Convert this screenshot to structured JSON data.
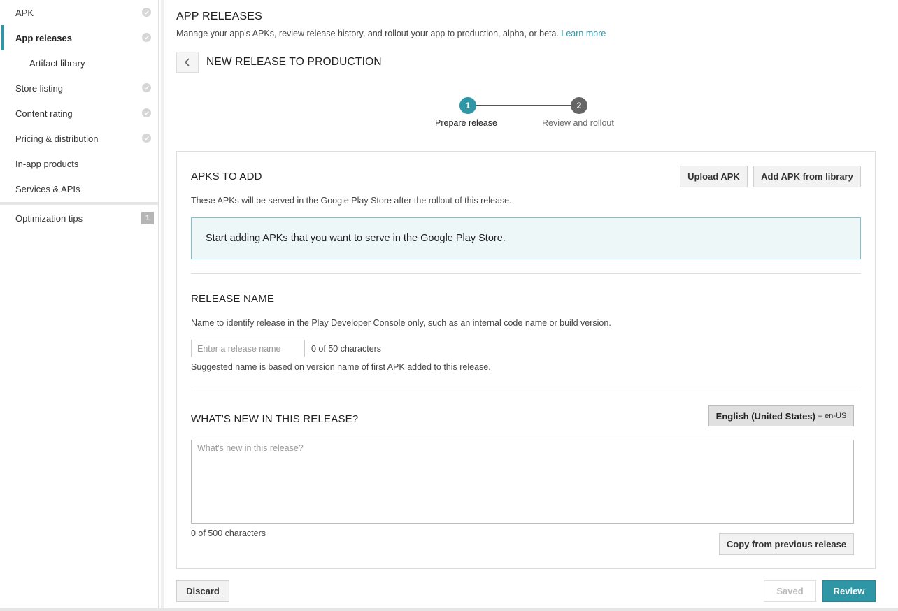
{
  "sidebar": {
    "items": [
      {
        "label": "APK"
      },
      {
        "label": "App releases"
      },
      {
        "label": "Artifact library"
      },
      {
        "label": "Store listing"
      },
      {
        "label": "Content rating"
      },
      {
        "label": "Pricing & distribution"
      },
      {
        "label": "In-app products"
      },
      {
        "label": "Services & APIs"
      }
    ],
    "optimization": {
      "label": "Optimization tips",
      "badge": "1"
    }
  },
  "header": {
    "title": "APP RELEASES",
    "description": "Manage your app's APKs, review release history, and rollout your app to production, alpha, or beta.",
    "learn_more": "Learn more",
    "page_title": "NEW RELEASE TO PRODUCTION"
  },
  "stepper": {
    "steps": [
      {
        "number": "1",
        "label": "Prepare release"
      },
      {
        "number": "2",
        "label": "Review and rollout"
      }
    ]
  },
  "apks": {
    "title": "APKS TO ADD",
    "upload_label": "Upload APK",
    "add_from_library_label": "Add APK from library",
    "description": "These APKs will be served in the Google Play Store after the rollout of this release.",
    "empty_message": "Start adding APKs that you want to serve in the Google Play Store."
  },
  "release_name": {
    "title": "RELEASE NAME",
    "description": "Name to identify release in the Play Developer Console only, such as an internal code name or build version.",
    "placeholder": "Enter a release name",
    "value": "",
    "counter": "0 of 50 characters",
    "hint": "Suggested name is based on version name of first APK added to this release."
  },
  "whats_new": {
    "title": "WHAT'S NEW IN THIS RELEASE?",
    "language_label": "English (United States)",
    "language_code": "– en-US",
    "placeholder": "What's new in this release?",
    "value": "",
    "counter": "0 of 500 characters",
    "copy_label": "Copy from previous release"
  },
  "footer": {
    "discard_label": "Discard",
    "saved_label": "Saved",
    "review_label": "Review"
  },
  "colors": {
    "accent": "#2e96a5",
    "info_bg": "#eef7f8"
  }
}
